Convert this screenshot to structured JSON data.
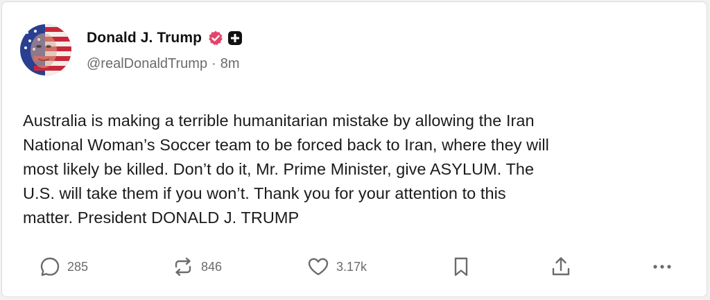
{
  "post": {
    "author": {
      "display_name": "Donald J. Trump",
      "handle": "@realDonaldTrump",
      "separator": "·",
      "time_ago": "8m",
      "avatar": "avatar-flag-portrait",
      "verified_badge": "verified-badge-icon",
      "plus_badge": "plus-badge-icon"
    },
    "text": "Australia is making a terrible humanitarian mistake by allowing the Iran\nNational Woman’s Soccer team to be forced back to Iran, where they will\nmost likely be killed. Don’t do it, Mr. Prime Minister, give ASYLUM. The\nU.S. will take them if you won’t. Thank you for your attention to this\nmatter. President DONALD J. TRUMP",
    "actions": {
      "reply": {
        "icon": "reply-icon",
        "count": "285"
      },
      "repost": {
        "icon": "repost-icon",
        "count": "846"
      },
      "like": {
        "icon": "heart-icon",
        "count": "3.17k"
      },
      "bookmark": {
        "icon": "bookmark-icon"
      },
      "share": {
        "icon": "share-icon"
      },
      "more": {
        "icon": "more-icon"
      }
    }
  },
  "colors": {
    "background": "#ffffff",
    "text_primary": "#111111",
    "text_secondary": "#6b6b6b",
    "verified_badge": "#e2456b",
    "plus_badge": "#111111"
  }
}
